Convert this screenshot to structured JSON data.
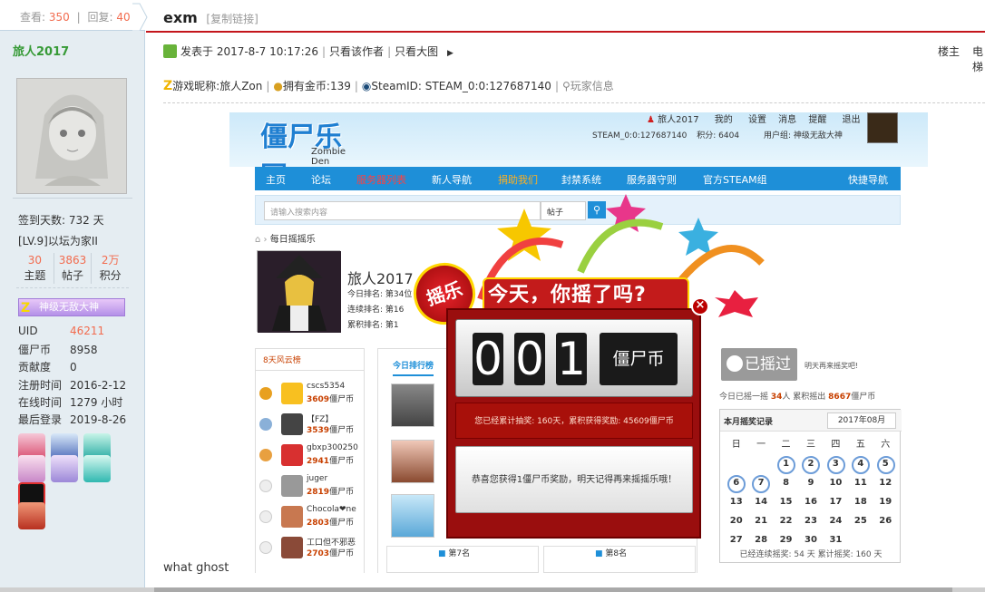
{
  "sidebar": {
    "views_label": "查看:",
    "views": "350",
    "sep": "|",
    "replies_label": "回复:",
    "replies": "40",
    "username": "旅人2017",
    "sign_days": "签到天数: 732 天",
    "level": "[LV.9]以坛为家II",
    "stats": [
      {
        "value": "30",
        "label": "主题"
      },
      {
        "value": "3863",
        "label": "帖子"
      },
      {
        "value": "2万",
        "label": "积分"
      }
    ],
    "medal": "神级无敌大神",
    "info": [
      {
        "k": "UID",
        "v": "46211",
        "red": true
      },
      {
        "k": "僵尸币",
        "v": "8958",
        "red": false
      },
      {
        "k": "贡献度",
        "v": "0",
        "red": false
      },
      {
        "k": "注册时间",
        "v": "2016-2-12",
        "red": false
      },
      {
        "k": "在线时间",
        "v": "1279 小时",
        "red": false
      },
      {
        "k": "最后登录",
        "v": "2019-8-26",
        "red": false
      }
    ]
  },
  "post": {
    "title": "exm",
    "copy_link": "[复制链接]",
    "posted_on": "发表于 2017-8-7 10:17:26",
    "only_author": "只看该作者",
    "big_image": "只看大图",
    "floor": "楼主",
    "electric": "电梯",
    "game_nick": "游戏昵称:旅人Zon",
    "coins": "拥有金币:139",
    "steam": "SteamID: STEAM_0:0:127687140",
    "player_info": "玩家信息",
    "body_text": "what ghost"
  },
  "embed": {
    "logo_text": "僵尸乐园",
    "logo_sub": "Zombie Den",
    "top_user": "旅人2017",
    "top_links": [
      "我的",
      "设置",
      "消息",
      "提醒",
      "退出"
    ],
    "steam_small": "STEAM_0:0:127687140",
    "points": "积分: 6404",
    "usergroup": "用户组: 神级无敌大神",
    "nav": [
      "主页",
      "论坛",
      "服务器列表",
      "新人导航",
      "捐助我们",
      "封禁系统",
      "服务器守则",
      "官方STEAM组",
      "快捷导航"
    ],
    "search_placeholder": "请输入搜索内容",
    "search_select": "帖子",
    "breadcrumb": "每日摇摇乐",
    "profile_name": "旅人2017",
    "profile_lines": [
      "今日排名: 第34位",
      "连续排名: 第16",
      "累积排名: 第1"
    ],
    "rank_title": "8天风云榜",
    "rank_rows": [
      {
        "name": "cscs5354",
        "val": "3609",
        "unit": "僵尸币"
      },
      {
        "name": "【FZ】",
        "val": "3539",
        "unit": "僵尸币"
      },
      {
        "name": "gbxp300250",
        "val": "2941",
        "unit": "僵尸币"
      },
      {
        "name": "juger",
        "val": "2819",
        "unit": "僵尸币"
      },
      {
        "name": "Chocola❤ne",
        "val": "2803",
        "unit": "僵尸币"
      },
      {
        "name": "工口但不邪恶",
        "val": "2703",
        "unit": "僵尸币"
      }
    ],
    "tab_today": "今日排行榜",
    "card7": "第7名",
    "card8": "第8名",
    "yaoguo": "已摇过",
    "next_time": "明天再来摇奖吧!",
    "today_info": "今日已摇一摇",
    "today_count": "34",
    "today_mid": "人 累积摇出",
    "today_total": "8667",
    "today_unit": "僵尸币",
    "cal_title": "本月摇奖记录",
    "cal_month": "2017年08月",
    "cal_weekdays": [
      "日",
      "一",
      "二",
      "三",
      "四",
      "五",
      "六"
    ],
    "cal_days": [
      [
        "",
        "",
        "1",
        "2",
        "3",
        "4",
        "5"
      ],
      [
        "6",
        "7",
        "8",
        "9",
        "10",
        "11",
        "12"
      ],
      [
        "13",
        "14",
        "15",
        "16",
        "17",
        "18",
        "19"
      ],
      [
        "20",
        "21",
        "22",
        "23",
        "24",
        "25",
        "26"
      ],
      [
        "27",
        "28",
        "29",
        "30",
        "31",
        "",
        ""
      ]
    ],
    "cal_footer": "已经连续摇奖: 54 天 累计摇奖: 160 天"
  },
  "popup": {
    "seal": "摇乐",
    "banner": "今天，你摇了吗?",
    "digits": [
      "0",
      "0",
      "1"
    ],
    "currency": "僵尸币",
    "summary": "您已经累计抽奖: 160天，累积获得奖励: 45609僵尸币",
    "message": "恭喜您获得1僵尸币奖励，明天记得再来摇摇乐哦！",
    "close": "×"
  }
}
